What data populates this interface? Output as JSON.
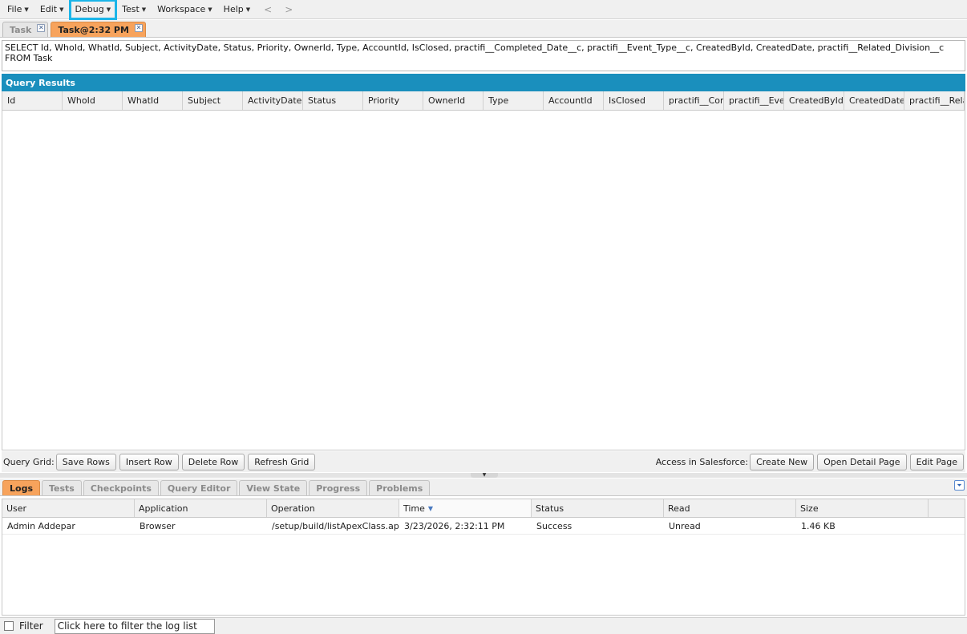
{
  "menu": {
    "items": [
      "File",
      "Edit",
      "Debug",
      "Test",
      "Workspace",
      "Help"
    ],
    "back": "<",
    "forward": ">"
  },
  "editor_tabs": [
    {
      "label": "Task",
      "active": false
    },
    {
      "label": "Task@2:32 PM",
      "active": true
    }
  ],
  "query": {
    "text": "SELECT Id, WhoId, WhatId, Subject, ActivityDate, Status, Priority, OwnerId, Type, AccountId, IsClosed, practifi__Completed_Date__c, practifi__Event_Type__c, CreatedById, CreatedDate, practifi__Related_Division__c FROM Task"
  },
  "results": {
    "title": "Query Results",
    "columns": [
      "Id",
      "WhoId",
      "WhatId",
      "Subject",
      "ActivityDate",
      "Status",
      "Priority",
      "OwnerId",
      "Type",
      "AccountId",
      "IsClosed",
      "practifi__Com",
      "practifi__Even",
      "CreatedById",
      "CreatedDate",
      "practifi__Relat"
    ]
  },
  "grid_toolbar": {
    "label": "Query Grid:",
    "save_rows": "Save Rows",
    "insert_row": "Insert Row",
    "delete_row": "Delete Row",
    "refresh_grid": "Refresh Grid",
    "access_label": "Access in Salesforce:",
    "create_new": "Create New",
    "open_detail": "Open Detail Page",
    "edit_page": "Edit Page"
  },
  "bottom_tabs": [
    "Logs",
    "Tests",
    "Checkpoints",
    "Query Editor",
    "View State",
    "Progress",
    "Problems"
  ],
  "logs": {
    "columns": [
      "User",
      "Application",
      "Operation",
      "Time",
      "Status",
      "Read",
      "Size"
    ],
    "rows": [
      [
        "Admin Addepar",
        "Browser",
        "/setup/build/listApexClass.ap...",
        "3/23/2026, 2:32:11 PM",
        "Success",
        "Unread",
        "1.46 KB"
      ]
    ]
  },
  "filter": {
    "label": "Filter",
    "placeholder": "Click here to filter the log list"
  }
}
